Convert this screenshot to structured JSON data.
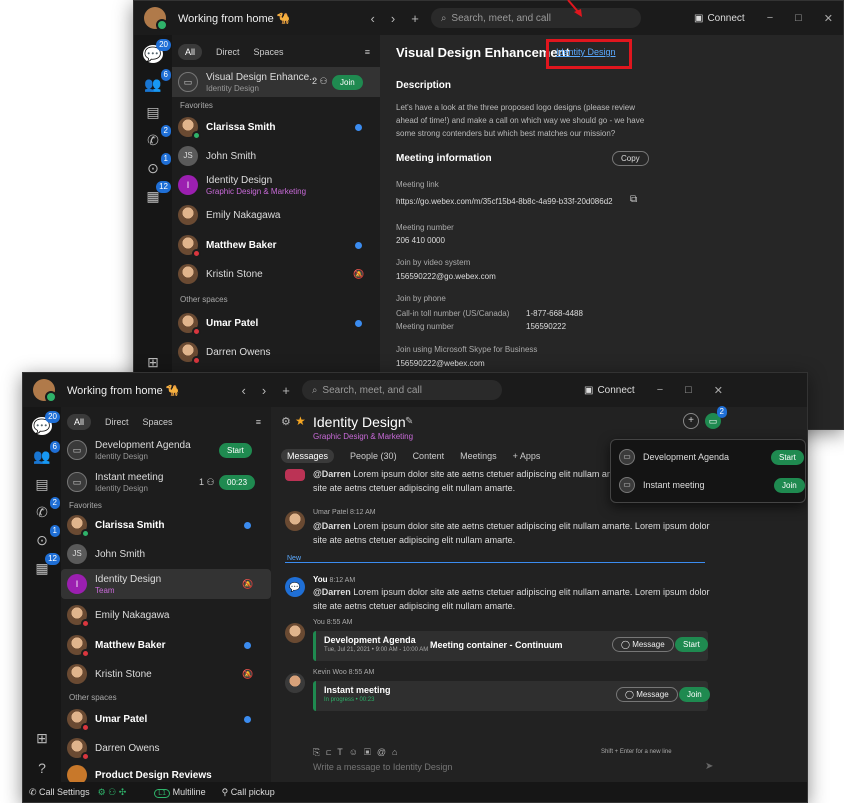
{
  "back": {
    "title_bar": {
      "status": "Working from home 🐪",
      "search_placeholder": "Search, meet, and call",
      "connect": "Connect"
    },
    "rail_badges": {
      "messages": "20",
      "teams": "6",
      "calls": "2",
      "voicemail": "1",
      "meetings": "12"
    },
    "tabs": [
      "All",
      "Direct",
      "Spaces"
    ],
    "list": [
      {
        "name": "Visual Design Enhance...",
        "sub": "Identity Design",
        "count": "2",
        "button": "Join"
      },
      {
        "section": "Favorites"
      },
      {
        "name": "Clarissa Smith"
      },
      {
        "name": "John Smith",
        "initials": "JS"
      },
      {
        "name": "Identity Design",
        "sub": "Graphic Design & Marketing",
        "initial": "I"
      },
      {
        "name": "Emily Nakagawa"
      },
      {
        "name": "Matthew Baker"
      },
      {
        "name": "Kristin Stone"
      },
      {
        "section": "Other spaces"
      },
      {
        "name": "Umar Patel"
      },
      {
        "name": "Darren Owens"
      }
    ],
    "main": {
      "title": "Visual Design Enhancement",
      "team_link": "Identity Design",
      "description_heading": "Description",
      "description": "Let's have a look at the three proposed logo designs (please review ahead of time!) and make a call on which way we should go - we have some strong contenders but which best matches our mission?",
      "meeting_info_heading": "Meeting information",
      "copy_button": "Copy",
      "meeting_link_label": "Meeting link",
      "meeting_link": "https://go.webex.com/m/35cf15b4-8b8c-4a99-b33f-20d086d2",
      "meeting_number_label": "Meeting number",
      "meeting_number": "206 410 0000",
      "video_label": "Join by video system",
      "video_address": "156590222@go.webex.com",
      "phone_label": "Join by phone",
      "tollfree_label": "Call-in toll number (US/Canada)",
      "tollfree": "1-877-668-4488",
      "phone_meeting_label": "Meeting number",
      "phone_meeting": "156590222",
      "skype_label": "Join using Microsoft Skype for Business",
      "skype_address": "156590222@webex.com"
    }
  },
  "front": {
    "title_bar": {
      "status": "Working from home 🐪",
      "search_placeholder": "Search, meet, and call",
      "connect": "Connect"
    },
    "rail_badges": {
      "messages": "20",
      "teams": "6",
      "calls": "2",
      "voicemail": "1",
      "meetings": "12"
    },
    "tabs": [
      "All",
      "Direct",
      "Spaces"
    ],
    "list": {
      "dev_agenda": {
        "name": "Development Agenda",
        "sub": "Identity Design",
        "button": "Start"
      },
      "instant": {
        "name": "Instant meeting",
        "sub": "Identity Design",
        "count": "1",
        "timer": "00:23"
      },
      "favorites": "Favorites",
      "clarissa": "Clarissa Smith",
      "john": "John Smith",
      "john_initials": "JS",
      "identity": "Identity Design",
      "identity_sub": "Team",
      "identity_initial": "I",
      "emily": "Emily Nakagawa",
      "matthew": "Matthew Baker",
      "kristin": "Kristin Stone",
      "other_spaces": "Other spaces",
      "umar": "Umar Patel",
      "darren": "Darren Owens",
      "product": "Product Design Reviews"
    },
    "space": {
      "title": "Identity Design",
      "subtitle": "Graphic Design & Marketing",
      "tabs": [
        "Messages",
        "People (30)",
        "Content",
        "Meetings",
        "+ Apps"
      ],
      "meeting_badge": "2"
    },
    "messages": [
      {
        "mention": "@Darren",
        "text": " Lorem ipsum dolor site ate aetns ctetuer adipiscing elit nullam amarte. Lorem ipsum dolor site ate aetns ctetuer adipiscing elit nullam amarte."
      },
      {
        "meta": "Umar Patel  8:12 AM",
        "mention": "@Darren",
        "text": " Lorem ipsum dolor site ate aetns ctetuer adipiscing elit nullam amarte. Lorem ipsum dolor site ate aetns ctetuer adipiscing elit nullam amarte."
      },
      {
        "new_label": "New"
      },
      {
        "author": "You",
        "time": "8:12 AM",
        "mention": "@Darren",
        "text": " Lorem ipsum dolor site ate aetns ctetuer adipiscing elit nullam amarte. Lorem ipsum dolor site ate aetns ctetuer adipiscing elit nullam amarte."
      }
    ],
    "cards": [
      {
        "meta": "You  8:55 AM",
        "title": "Development Agenda",
        "sub": "Tue, Jul 21, 2021  •  9:00 AM - 10:00 AM",
        "overlay": "Meeting container - Continuum",
        "msg_button": "Message",
        "button": "Start"
      },
      {
        "meta": "Kevin Woo  8:55 AM",
        "title": "Instant meeting",
        "sub": "In progress  •  00:23",
        "msg_button": "Message",
        "button": "Join"
      }
    ],
    "composer": {
      "placeholder": "Write a message to Identity Design",
      "hint": "Shift + Enter for a new line"
    },
    "popup": [
      {
        "name": "Development Agenda",
        "button": "Start"
      },
      {
        "name": "Instant meeting",
        "button": "Join"
      }
    ],
    "footer": {
      "call_settings": "Call Settings",
      "line": "Multiline",
      "line_badge": "L1",
      "pickup": "Call pickup"
    }
  },
  "colors": {
    "accent_green": "#1f8a50",
    "highlight_red": "#e0161e",
    "link_blue": "#5aa9ff",
    "unread_blue": "#3b8cf0"
  }
}
